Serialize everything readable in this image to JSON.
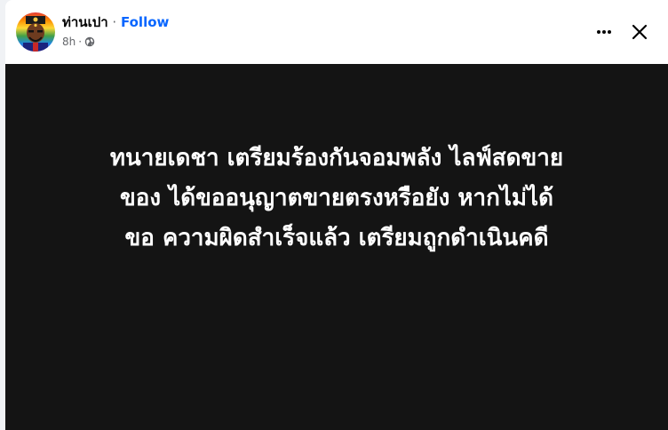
{
  "post": {
    "author": "ท่านเปา",
    "separator": "·",
    "follow_label": "Follow",
    "time": "8h",
    "meta_separator": "·",
    "privacy_icon": "globe-icon",
    "text_lines": [
      "ทนายเดชา เตรียมร้องกันจอมพลัง ไลฟ์สดขาย",
      "ของ ได้ขออนุญาตขายตรงหรือยัง หากไม่ได้",
      "ขอ ความผิดสำเร็จแล้ว เตรียมถูกดำเนินคดี"
    ]
  },
  "controls": {
    "more_icon": "more-horizontal-icon",
    "close_icon": "close-icon"
  },
  "colors": {
    "accent": "#0866ff",
    "media_background": "#141414",
    "text_secondary": "#65676b"
  }
}
